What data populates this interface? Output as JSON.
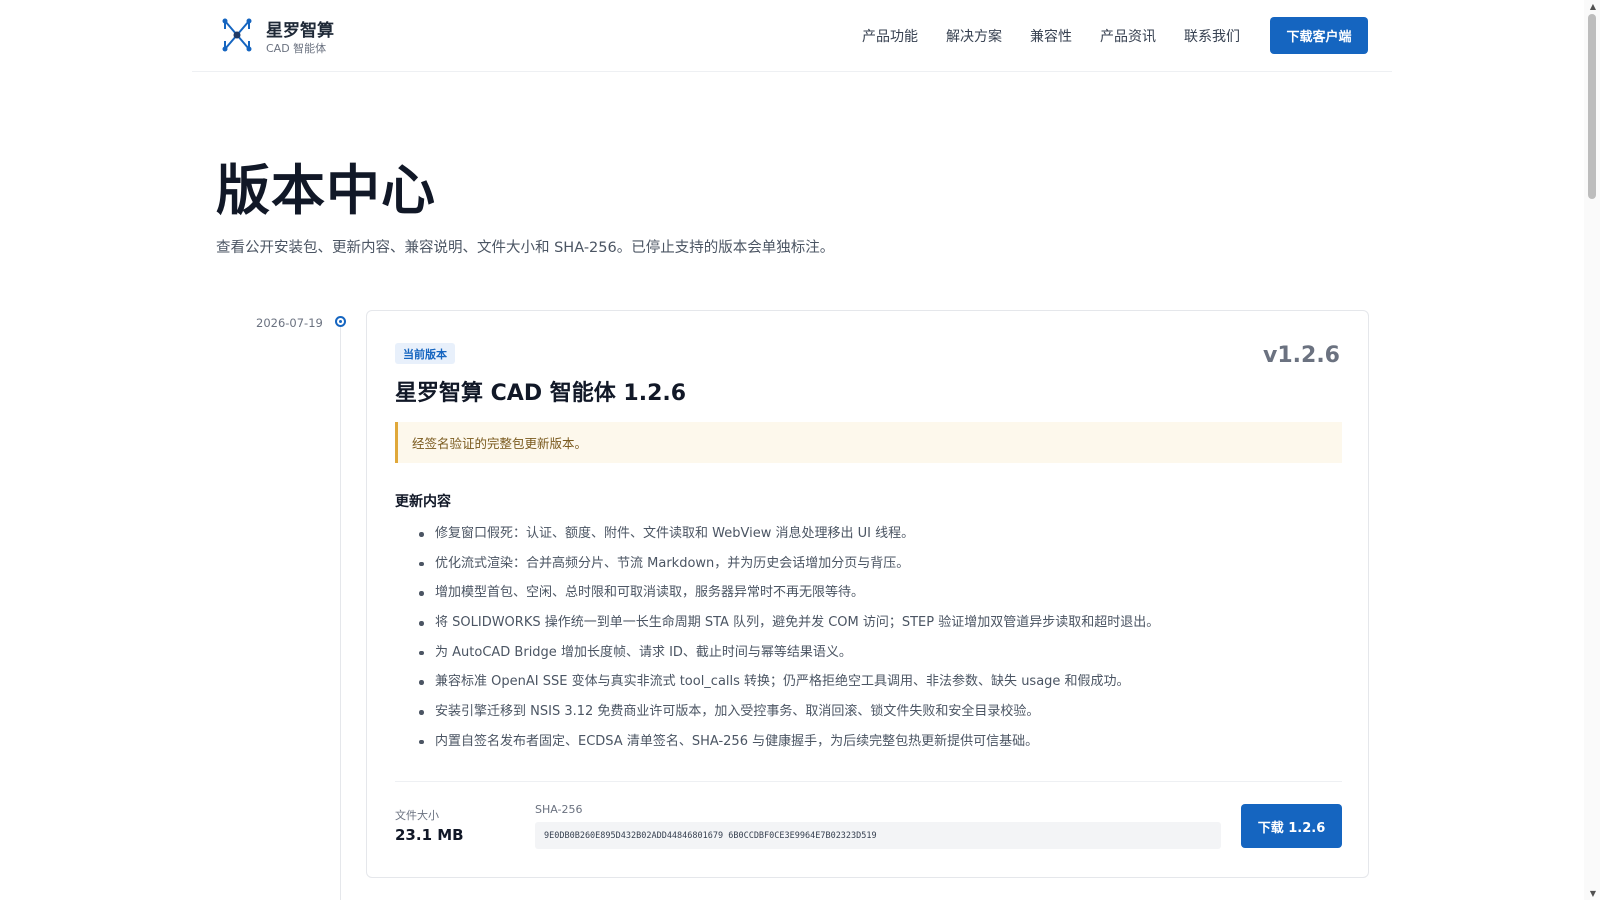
{
  "header": {
    "brand_name": "星罗智算",
    "brand_sub": "CAD 智能体",
    "nav": [
      "产品功能",
      "解决方案",
      "兼容性",
      "产品资讯",
      "联系我们"
    ],
    "download_label": "下载客户端"
  },
  "page": {
    "title": "版本中心",
    "description": "查看公开安装包、更新内容、兼容说明、文件大小和 SHA-256。已停止支持的版本会单独标注。"
  },
  "release": {
    "date": "2026-07-19",
    "badge": "当前版本",
    "version_tag": "v1.2.6",
    "title": "星罗智算 CAD 智能体 1.2.6",
    "notice": "经签名验证的完整包更新版本。",
    "changes_title": "更新内容",
    "changes": [
      "修复窗口假死：认证、额度、附件、文件读取和 WebView 消息处理移出 UI 线程。",
      "优化流式渲染：合并高频分片、节流 Markdown，并为历史会话增加分页与背压。",
      "增加模型首包、空闲、总时限和可取消读取，服务器异常时不再无限等待。",
      "将 SOLIDWORKS 操作统一到单一长生命周期 STA 队列，避免并发 COM 访问；STEP 验证增加双管道异步读取和超时退出。",
      "为 AutoCAD Bridge 增加长度帧、请求 ID、截止时间与幂等结果语义。",
      "兼容标准 OpenAI SSE 变体与真实非流式 tool_calls 转换；仍严格拒绝空工具调用、非法参数、缺失 usage 和假成功。",
      "安装引擎迁移到 NSIS 3.12 免费商业许可版本，加入受控事务、取消回滚、锁文件失败和安全目录校验。",
      "内置自签名发布者固定、ECDSA 清单签名、SHA-256 与健康握手，为后续完整包热更新提供可信基础。"
    ],
    "size_label": "文件大小",
    "size_value": "23.1 MB",
    "sha_label": "SHA-256",
    "sha_value": "9E0DB0B260E895D432B02ADD44846801679 6B0CCDBF0CE3E9964E7B02323D519",
    "download_label": "下载 1.2.6"
  },
  "colors": {
    "accent": "#1565c0",
    "notice_border": "#e0a83a",
    "notice_bg": "#fdf8ec"
  },
  "scrollbar": {
    "up_icon": "▲",
    "down_icon": "▼"
  }
}
